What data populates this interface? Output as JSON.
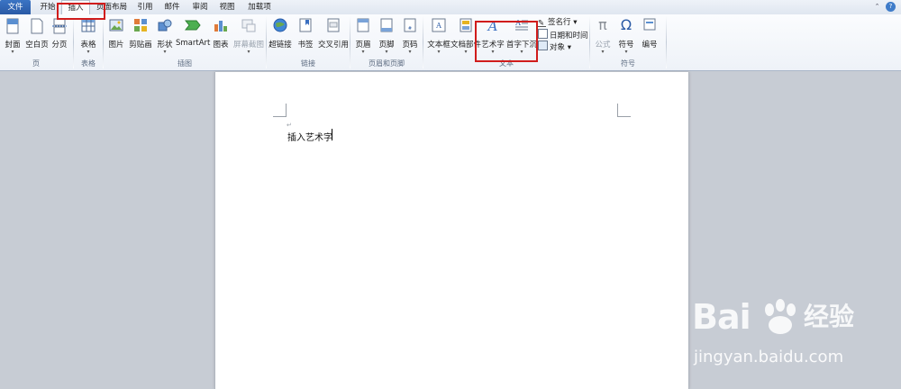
{
  "tabs": [
    {
      "label": "文件",
      "id": "file"
    },
    {
      "label": "开始",
      "id": "home"
    },
    {
      "label": "插入",
      "id": "insert"
    },
    {
      "label": "页面布局",
      "id": "layout"
    },
    {
      "label": "引用",
      "id": "references"
    },
    {
      "label": "邮件",
      "id": "mailings"
    },
    {
      "label": "审阅",
      "id": "review"
    },
    {
      "label": "视图",
      "id": "view"
    },
    {
      "label": "加载项",
      "id": "addins"
    }
  ],
  "active_tab": "插入",
  "groups": {
    "pages": {
      "label": "页",
      "cover": "封面",
      "blank": "空白页",
      "break": "分页"
    },
    "tables": {
      "label": "表格",
      "table": "表格"
    },
    "illustrations": {
      "label": "插图",
      "picture": "图片",
      "clipart": "剪贴画",
      "shapes": "形状",
      "smartart": "SmartArt",
      "chart": "图表",
      "screenshot": "屏幕截图"
    },
    "links": {
      "label": "链接",
      "hyperlink": "超链接",
      "bookmark": "书签",
      "crossref": "交叉引用"
    },
    "header_footer": {
      "label": "页眉和页脚",
      "header": "页眉",
      "footer": "页脚",
      "pagenum": "页码"
    },
    "text": {
      "label": "文本",
      "textbox": "文本框",
      "quickparts": "文档部件",
      "wordart": "艺术字",
      "dropcap": "首字下沉",
      "signature": "签名行",
      "datetime": "日期和时间",
      "object": "对象"
    },
    "symbols": {
      "label": "符号",
      "equation": "公式",
      "symbol": "符号",
      "number": "编号"
    }
  },
  "document": {
    "text": "插入艺术字",
    "para_mark": "↵"
  },
  "watermark": {
    "brand": "Bai",
    "brand_cn": "经验",
    "url": "jingyan.baidu.com"
  },
  "colors": {
    "accent": "#2a5aa6",
    "highlight": "#d01c1c"
  }
}
